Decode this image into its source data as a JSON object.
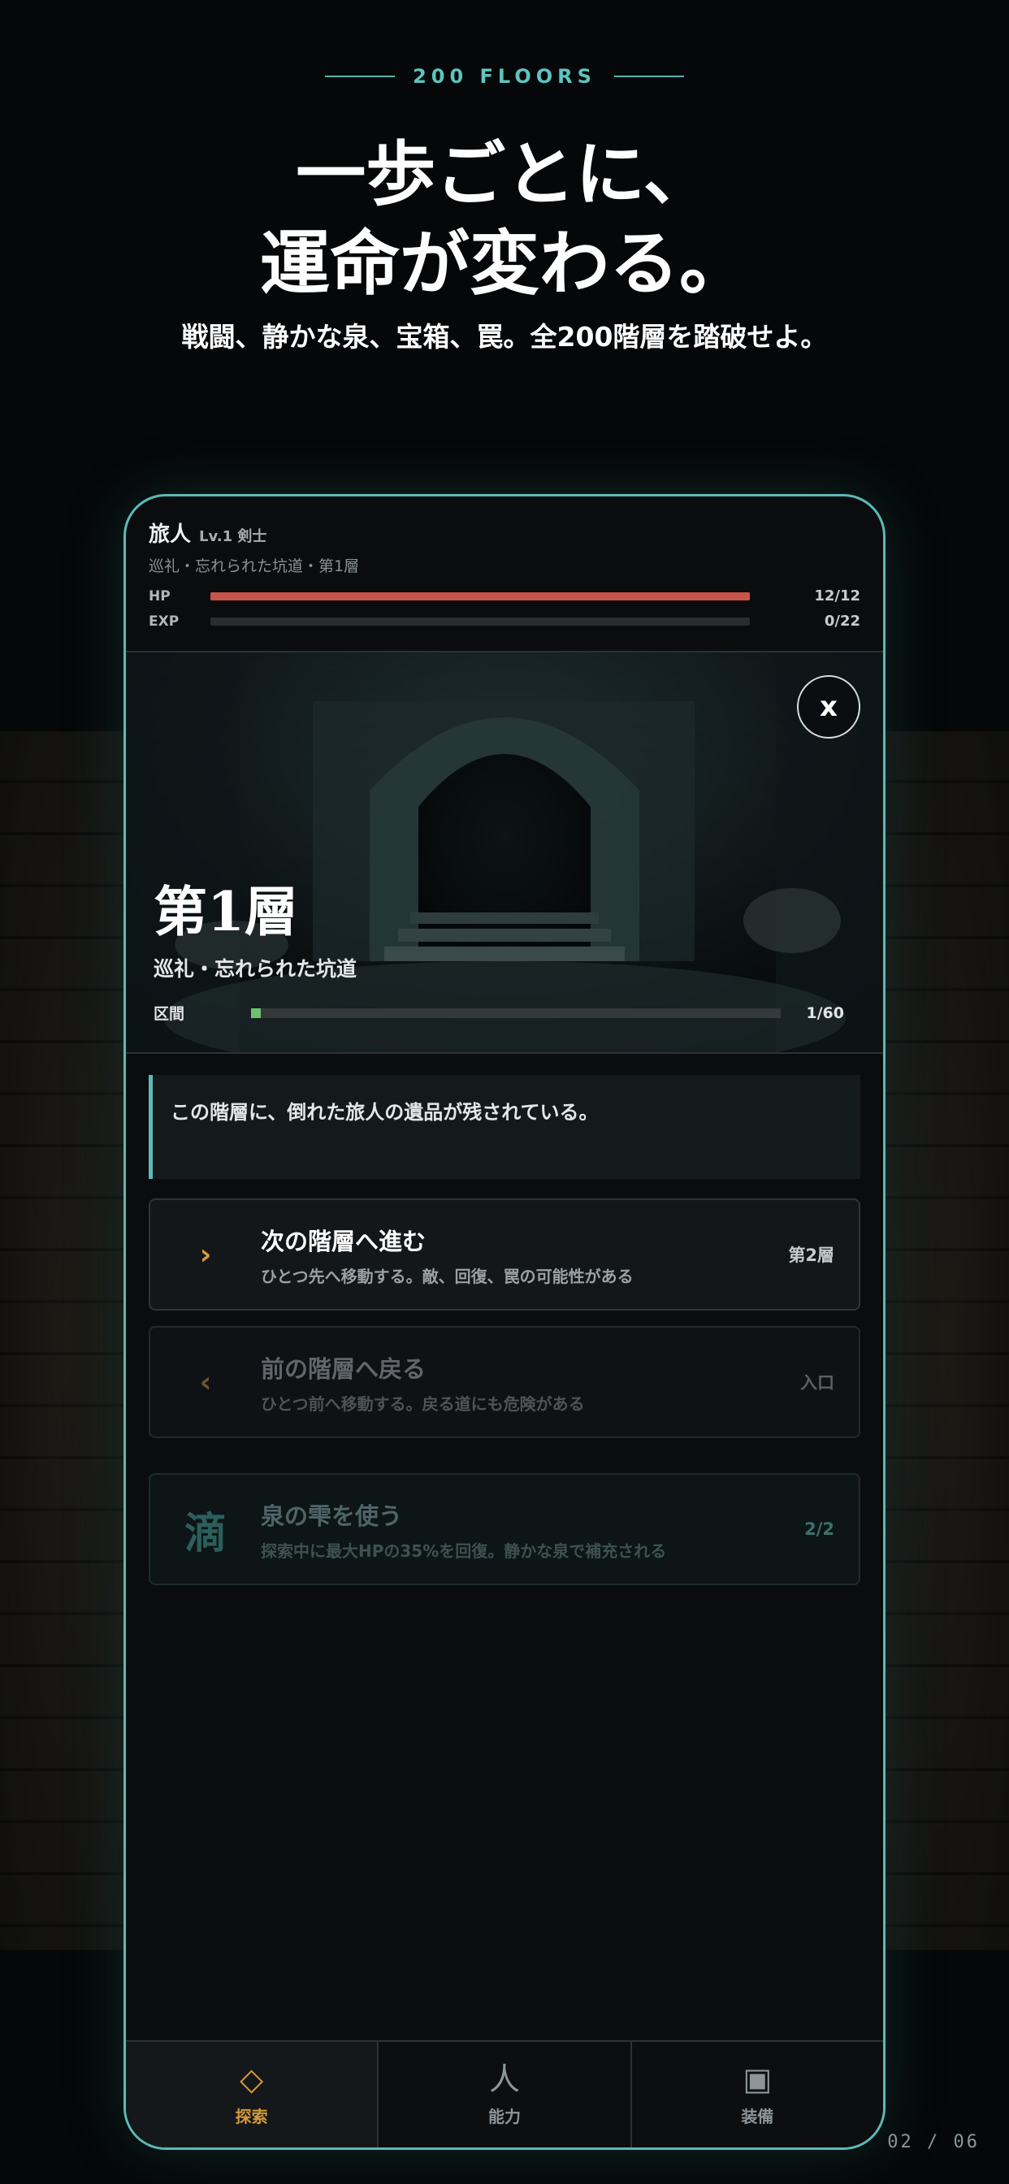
{
  "header": {
    "eyebrow": "200 FLOORS",
    "headline_line1": "一歩ごとに、",
    "headline_line2": "運命が変わる。",
    "subline": "戦闘、静かな泉、宝箱、罠。全200階層を踏破せよ。"
  },
  "page_indicator": "02 / 06",
  "status": {
    "name": "旅人",
    "class_level": "Lv.1 剣士",
    "location": "巡礼・忘れられた坑道・第1層",
    "hp_label": "HP",
    "hp_value": "12/12",
    "hp_fraction": 1.0,
    "hp_color": "#c9554a",
    "exp_label": "EXP",
    "exp_value": "0/22",
    "exp_fraction": 0.0,
    "exp_color": "#6ec070"
  },
  "scene": {
    "close_label": "x",
    "floor_title": "第1層",
    "floor_subtitle": "巡礼・忘れられた坑道",
    "section_label": "区間",
    "section_value": "1/60",
    "section_fraction": 0.0167
  },
  "message": "この階層に、倒れた旅人の遺品が残されている。",
  "actions": {
    "next": {
      "icon": "chevron-right-icon",
      "glyph": "›",
      "title": "次の階層へ進む",
      "desc": "ひとつ先へ移動する。敵、回復、罠の可能性がある",
      "tag": "第2層"
    },
    "prev": {
      "icon": "chevron-left-icon",
      "glyph": "‹",
      "title": "前の階層へ戻る",
      "desc": "ひとつ前へ移動する。戻る道にも危険がある",
      "tag": "入口"
    },
    "potion": {
      "icon": "drop-kanji-icon",
      "glyph": "滴",
      "title": "泉の雫を使う",
      "desc": "探索中に最大HPの35%を回復。静かな泉で補充される",
      "tag": "2/2"
    }
  },
  "tabs": [
    {
      "icon": "diamond-icon",
      "glyph": "◇",
      "label": "探索",
      "active": true
    },
    {
      "icon": "person-kanji-icon",
      "glyph": "人",
      "label": "能力",
      "active": false
    },
    {
      "icon": "square-icon",
      "glyph": "▣",
      "label": "装備",
      "active": false
    }
  ],
  "colors": {
    "accent_teal": "#5bbab6",
    "accent_gold": "#d29a3a"
  }
}
